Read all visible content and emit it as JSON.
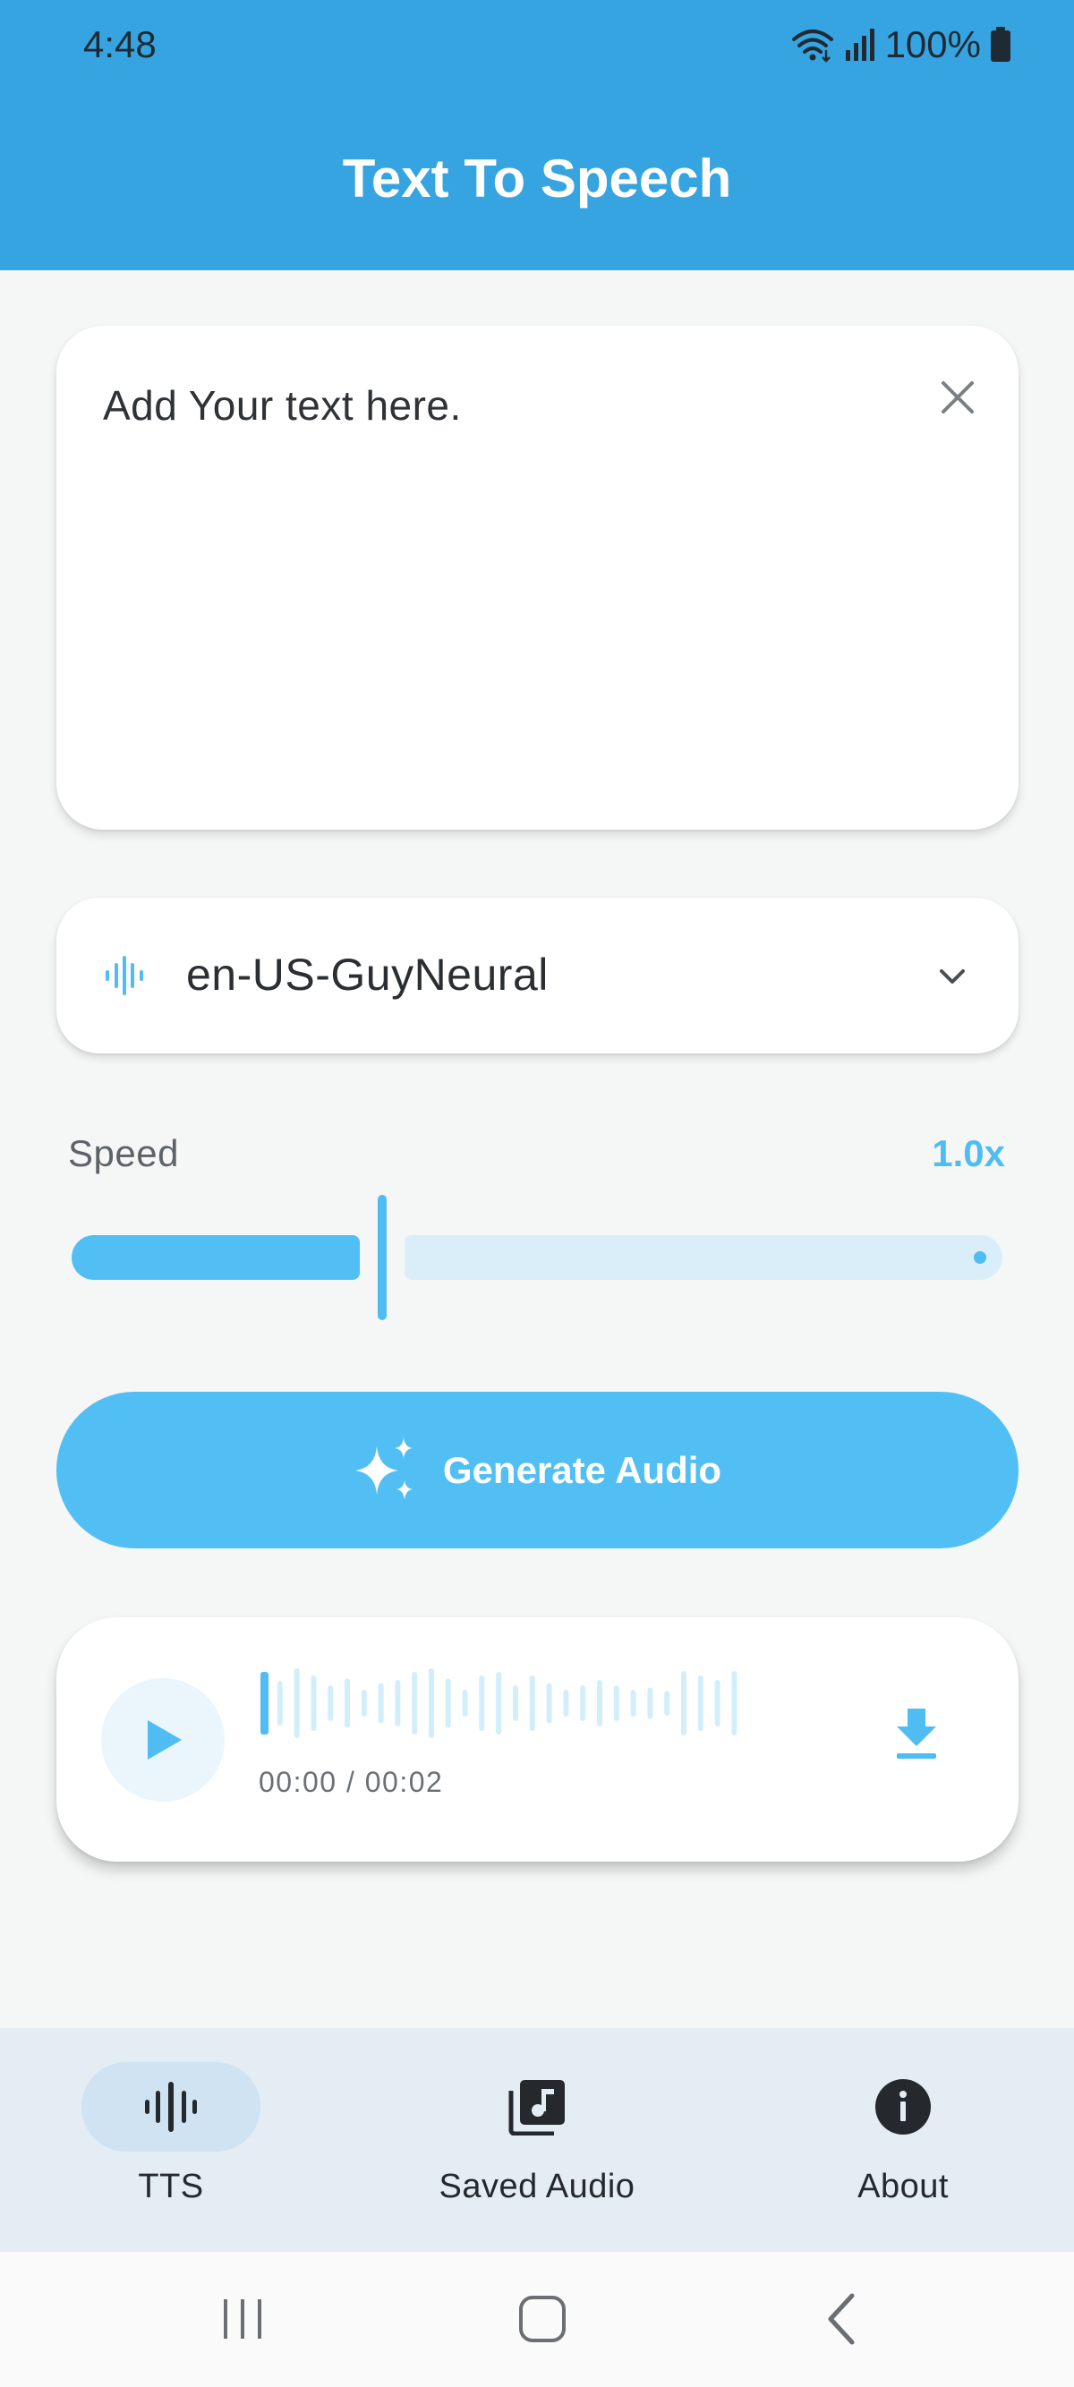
{
  "status_bar": {
    "time": "4:48",
    "battery": "100%"
  },
  "app": {
    "title": "Text To Speech"
  },
  "text_input": {
    "placeholder": "Add Your text here."
  },
  "voice": {
    "selected": "en-US-GuyNeural"
  },
  "speed": {
    "label": "Speed",
    "value_text": "1.0x",
    "fraction": 0.33
  },
  "generate": {
    "label": "Generate Audio"
  },
  "player": {
    "time": "00:00 / 00:02",
    "progress": 0.0
  },
  "bottom_nav": {
    "items": [
      {
        "label": "TTS",
        "icon": "waveform-icon",
        "active": true
      },
      {
        "label": "Saved Audio",
        "icon": "music-library-icon",
        "active": false
      },
      {
        "label": "About",
        "icon": "info-icon",
        "active": false
      }
    ]
  },
  "colors": {
    "app_bar": "#36a4e0",
    "accent": "#52bff4",
    "slider_track": "#d9eef8",
    "nav_background": "#e4ecf4"
  }
}
